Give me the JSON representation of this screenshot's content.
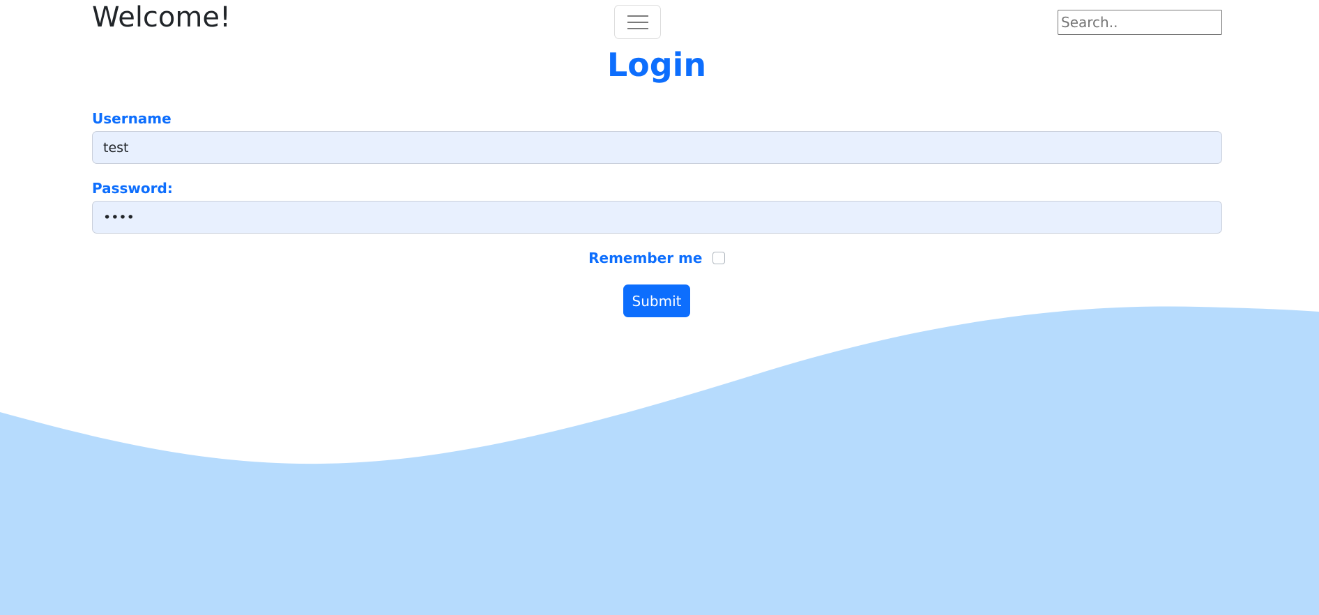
{
  "header": {
    "brand": "Welcome!",
    "menu_icon": "hamburger-menu-icon",
    "search": {
      "placeholder": "Search..",
      "value": ""
    }
  },
  "login": {
    "title": "Login",
    "username": {
      "label": "Username",
      "value": "test"
    },
    "password": {
      "label": "Password:",
      "value": "••••"
    },
    "remember": {
      "label": "Remember me",
      "checked": false
    },
    "submit_label": "Submit"
  },
  "colors": {
    "accent": "#0d6efd",
    "field_background": "#e8f0fe",
    "wave": "#b6dbfd",
    "background": "#ffffff"
  }
}
